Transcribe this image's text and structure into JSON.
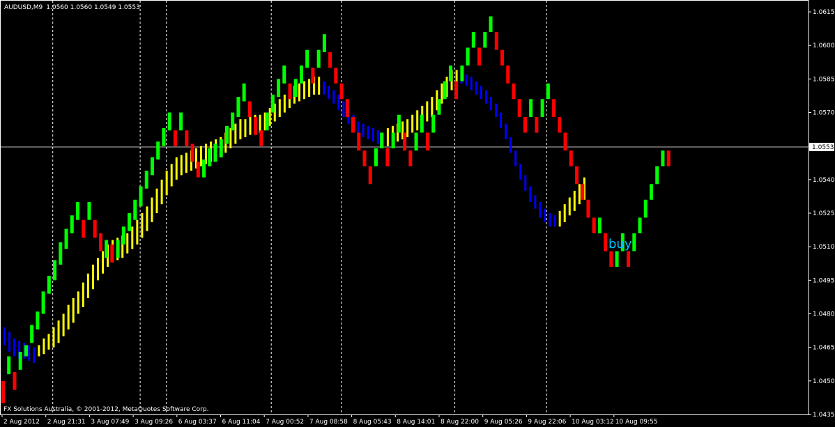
{
  "header": {
    "symbol": "AUDUSD,M9",
    "ohlc": "1.0560 1.0560 1.0549 1.0553"
  },
  "footer": {
    "copyright": "FX Solutions Australia, © 2001-2012, MetaQuotes Software Corp."
  },
  "colors": {
    "background": "#000000",
    "frame": "#ffffff",
    "grid": "#ffffff",
    "bull_candle": "#00ff00",
    "bear_candle": "#ff0000",
    "overlay_yellow": "#ffff00",
    "overlay_blue": "#0000ff",
    "signal_text": "#00bfff"
  },
  "chart_data": {
    "type": "ohlc-bars",
    "title": "AUDUSD,M9",
    "ylim": [
      1.0435,
      1.062
    ],
    "y_ticks": [
      "1.0615",
      "1.0600",
      "1.0585",
      "1.0570",
      "1.0555",
      "1.0540",
      "1.0525",
      "1.0510",
      "1.0495",
      "1.0480",
      "1.0465",
      "1.0450",
      "1.0435"
    ],
    "current_price": "1.0553",
    "x_labels": [
      "2 Aug 2012",
      "2 Aug 21:31",
      "3 Aug 07:49",
      "3 Aug 09:26",
      "6 Aug 03:37",
      "6 Aug 11:04",
      "7 Aug 00:52",
      "7 Aug 08:58",
      "8 Aug 05:43",
      "8 Aug 14:01",
      "8 Aug 22:00",
      "9 Aug 05:26",
      "9 Aug 22:06",
      "10 Aug 03:12",
      "10 Aug 09:55"
    ],
    "period_separators_after_label": [
      1,
      3,
      3.6,
      6,
      7.6,
      10.2,
      12.3
    ],
    "annotation": {
      "text": "buy"
    },
    "bars": [
      [
        1.045,
        1.044,
        "r"
      ],
      [
        1.0453,
        1.0461,
        "g"
      ],
      [
        1.0446,
        1.0454,
        "r"
      ],
      [
        1.0455,
        1.0463,
        "g"
      ],
      [
        1.0461,
        1.0466,
        "g"
      ],
      [
        1.0467,
        1.0475,
        "g"
      ],
      [
        1.0473,
        1.0481,
        "g"
      ],
      [
        1.048,
        1.049,
        "g"
      ],
      [
        1.0489,
        1.0497,
        "g"
      ],
      [
        1.0495,
        1.0504,
        "g"
      ],
      [
        1.0502,
        1.0512,
        "g"
      ],
      [
        1.0509,
        1.0518,
        "g"
      ],
      [
        1.0516,
        1.0524,
        "g"
      ],
      [
        1.0522,
        1.053,
        "g"
      ],
      [
        1.0522,
        1.0514,
        "r"
      ],
      [
        1.0522,
        1.053,
        "g"
      ],
      [
        1.0522,
        1.0514,
        "r"
      ],
      [
        1.0508,
        1.0516,
        "r"
      ],
      [
        1.0505,
        1.0513,
        "g"
      ],
      [
        1.0503,
        1.0511,
        "r"
      ],
      [
        1.0505,
        1.0513,
        "g"
      ],
      [
        1.0511,
        1.0519,
        "g"
      ],
      [
        1.0517,
        1.0525,
        "g"
      ],
      [
        1.0522,
        1.0531,
        "g"
      ],
      [
        1.0528,
        1.0537,
        "g"
      ],
      [
        1.0536,
        1.0544,
        "g"
      ],
      [
        1.0542,
        1.055,
        "g"
      ],
      [
        1.0549,
        1.0557,
        "g"
      ],
      [
        1.0555,
        1.0563,
        "g"
      ],
      [
        1.0562,
        1.057,
        "g"
      ],
      [
        1.0562,
        1.0555,
        "r"
      ],
      [
        1.0562,
        1.057,
        "g"
      ],
      [
        1.0562,
        1.0555,
        "r"
      ],
      [
        1.0556,
        1.0548,
        "r"
      ],
      [
        1.0548,
        1.0541,
        "r"
      ],
      [
        1.0541,
        1.0549,
        "g"
      ],
      [
        1.0546,
        1.0554,
        "g"
      ],
      [
        1.0548,
        1.0556,
        "g"
      ],
      [
        1.055,
        1.0558,
        "g"
      ],
      [
        1.0556,
        1.0564,
        "g"
      ],
      [
        1.0562,
        1.057,
        "g"
      ],
      [
        1.0568,
        1.0577,
        "g"
      ],
      [
        1.0575,
        1.0583,
        "g"
      ],
      [
        1.0575,
        1.0568,
        "r"
      ],
      [
        1.0568,
        1.056,
        "r"
      ],
      [
        1.0562,
        1.0555,
        "r"
      ],
      [
        1.0562,
        1.057,
        "g"
      ],
      [
        1.057,
        1.0578,
        "g"
      ],
      [
        1.0577,
        1.0585,
        "g"
      ],
      [
        1.0583,
        1.0591,
        "g"
      ],
      [
        1.0583,
        1.0576,
        "r"
      ],
      [
        1.0577,
        1.0585,
        "g"
      ],
      [
        1.0583,
        1.0591,
        "g"
      ],
      [
        1.059,
        1.0598,
        "g"
      ],
      [
        1.059,
        1.0583,
        "r"
      ],
      [
        1.059,
        1.0598,
        "g"
      ],
      [
        1.0597,
        1.0605,
        "g"
      ],
      [
        1.0597,
        1.059,
        "r"
      ],
      [
        1.059,
        1.0583,
        "r"
      ],
      [
        1.0583,
        1.0576,
        "r"
      ],
      [
        1.0576,
        1.0568,
        "r"
      ],
      [
        1.0568,
        1.0561,
        "r"
      ],
      [
        1.0561,
        1.0553,
        "r"
      ],
      [
        1.0553,
        1.0546,
        "r"
      ],
      [
        1.0546,
        1.0538,
        "r"
      ],
      [
        1.0546,
        1.0554,
        "g"
      ],
      [
        1.0554,
        1.0561,
        "g"
      ],
      [
        1.0554,
        1.0546,
        "r"
      ],
      [
        1.0554,
        1.0561,
        "g"
      ],
      [
        1.0561,
        1.0569,
        "g"
      ],
      [
        1.0561,
        1.0553,
        "r"
      ],
      [
        1.0553,
        1.0546,
        "r"
      ],
      [
        1.0553,
        1.0561,
        "g"
      ],
      [
        1.0561,
        1.0569,
        "g"
      ],
      [
        1.0561,
        1.0553,
        "r"
      ],
      [
        1.0561,
        1.0569,
        "g"
      ],
      [
        1.0569,
        1.0576,
        "g"
      ],
      [
        1.0576,
        1.0584,
        "g"
      ],
      [
        1.0584,
        1.0591,
        "g"
      ],
      [
        1.0584,
        1.0576,
        "r"
      ],
      [
        1.0584,
        1.0591,
        "g"
      ],
      [
        1.0591,
        1.0599,
        "g"
      ],
      [
        1.0599,
        1.0606,
        "g"
      ],
      [
        1.0599,
        1.0591,
        "r"
      ],
      [
        1.0599,
        1.0606,
        "g"
      ],
      [
        1.0606,
        1.0613,
        "g"
      ],
      [
        1.0606,
        1.0598,
        "r"
      ],
      [
        1.0598,
        1.0591,
        "r"
      ],
      [
        1.0591,
        1.0583,
        "r"
      ],
      [
        1.0583,
        1.0576,
        "r"
      ],
      [
        1.0576,
        1.0568,
        "r"
      ],
      [
        1.0568,
        1.0561,
        "r"
      ],
      [
        1.0568,
        1.0576,
        "g"
      ],
      [
        1.0568,
        1.0561,
        "r"
      ],
      [
        1.0568,
        1.0576,
        "g"
      ],
      [
        1.0576,
        1.0583,
        "g"
      ],
      [
        1.0576,
        1.0568,
        "r"
      ],
      [
        1.0568,
        1.0561,
        "r"
      ],
      [
        1.0561,
        1.0553,
        "r"
      ],
      [
        1.0553,
        1.0546,
        "r"
      ],
      [
        1.0546,
        1.0538,
        "r"
      ],
      [
        1.0538,
        1.0531,
        "r"
      ],
      [
        1.0531,
        1.0523,
        "r"
      ],
      [
        1.0523,
        1.0516,
        "r"
      ],
      [
        1.0516,
        1.0523,
        "g"
      ],
      [
        1.0516,
        1.0508,
        "r"
      ],
      [
        1.0508,
        1.0501,
        "r"
      ],
      [
        1.0501,
        1.0508,
        "g"
      ],
      [
        1.0508,
        1.0516,
        "g"
      ],
      [
        1.0508,
        1.0501,
        "r"
      ],
      [
        1.0508,
        1.0516,
        "g"
      ],
      [
        1.0516,
        1.0523,
        "g"
      ],
      [
        1.0523,
        1.0531,
        "g"
      ],
      [
        1.0531,
        1.0538,
        "g"
      ],
      [
        1.0538,
        1.0546,
        "g"
      ],
      [
        1.0546,
        1.0553,
        "g"
      ],
      [
        1.0553,
        1.0546,
        "r"
      ]
    ],
    "overlay": [
      [
        1.0474,
        1.0466,
        "b"
      ],
      [
        1.0472,
        1.0463,
        "b"
      ],
      [
        1.0469,
        1.0461,
        "b"
      ],
      [
        1.0468,
        1.046,
        "b"
      ],
      [
        1.0467,
        1.046,
        "b"
      ],
      [
        1.0466,
        1.0459,
        "b"
      ],
      [
        1.0465,
        1.0458,
        "b"
      ],
      [
        1.0466,
        1.0461,
        "y"
      ],
      [
        1.0469,
        1.0462,
        "y"
      ],
      [
        1.0471,
        1.0464,
        "y"
      ],
      [
        1.0474,
        1.0465,
        "y"
      ],
      [
        1.0477,
        1.0467,
        "y"
      ],
      [
        1.048,
        1.047,
        "y"
      ],
      [
        1.0484,
        1.0473,
        "y"
      ],
      [
        1.0487,
        1.0476,
        "y"
      ],
      [
        1.049,
        1.048,
        "y"
      ],
      [
        1.0494,
        1.0483,
        "y"
      ],
      [
        1.0498,
        1.0487,
        "y"
      ],
      [
        1.0502,
        1.0491,
        "y"
      ],
      [
        1.0505,
        1.0495,
        "y"
      ],
      [
        1.0508,
        1.0498,
        "y"
      ],
      [
        1.0511,
        1.0501,
        "y"
      ],
      [
        1.0513,
        1.0503,
        "y"
      ],
      [
        1.0514,
        1.0504,
        "y"
      ],
      [
        1.0515,
        1.0505,
        "y"
      ],
      [
        1.0516,
        1.0507,
        "y"
      ],
      [
        1.0519,
        1.0509,
        "y"
      ],
      [
        1.0522,
        1.0511,
        "y"
      ],
      [
        1.0525,
        1.0514,
        "y"
      ],
      [
        1.0528,
        1.0517,
        "y"
      ],
      [
        1.0532,
        1.0521,
        "y"
      ],
      [
        1.0536,
        1.0525,
        "y"
      ],
      [
        1.054,
        1.0529,
        "y"
      ],
      [
        1.0544,
        1.0533,
        "y"
      ],
      [
        1.0547,
        1.0537,
        "y"
      ],
      [
        1.055,
        1.054,
        "y"
      ],
      [
        1.0551,
        1.0542,
        "y"
      ],
      [
        1.0552,
        1.0543,
        "y"
      ],
      [
        1.0553,
        1.0544,
        "y"
      ],
      [
        1.0554,
        1.0545,
        "y"
      ],
      [
        1.0555,
        1.0546,
        "y"
      ],
      [
        1.0556,
        1.0547,
        "y"
      ],
      [
        1.0557,
        1.0548,
        "y"
      ],
      [
        1.0558,
        1.0549,
        "y"
      ],
      [
        1.0559,
        1.055,
        "y"
      ],
      [
        1.0561,
        1.0552,
        "y"
      ],
      [
        1.0563,
        1.0554,
        "y"
      ],
      [
        1.0565,
        1.0556,
        "y"
      ],
      [
        1.0567,
        1.0558,
        "y"
      ],
      [
        1.0567,
        1.0559,
        "y"
      ],
      [
        1.0568,
        1.056,
        "y"
      ],
      [
        1.0569,
        1.0561,
        "y"
      ],
      [
        1.0569,
        1.0561,
        "y"
      ],
      [
        1.057,
        1.0562,
        "y"
      ],
      [
        1.0572,
        1.0564,
        "y"
      ],
      [
        1.0574,
        1.0566,
        "y"
      ],
      [
        1.0576,
        1.0568,
        "y"
      ],
      [
        1.0578,
        1.057,
        "y"
      ],
      [
        1.058,
        1.0572,
        "y"
      ],
      [
        1.0582,
        1.0574,
        "y"
      ],
      [
        1.0583,
        1.0575,
        "y"
      ],
      [
        1.0584,
        1.0576,
        "y"
      ],
      [
        1.0585,
        1.0577,
        "y"
      ],
      [
        1.0586,
        1.0578,
        "y"
      ],
      [
        1.0586,
        1.0578,
        "y"
      ],
      [
        1.0584,
        1.0578,
        "b"
      ],
      [
        1.0582,
        1.0576,
        "b"
      ],
      [
        1.058,
        1.0574,
        "b"
      ],
      [
        1.0578,
        1.0571,
        "b"
      ],
      [
        1.0575,
        1.0568,
        "b"
      ],
      [
        1.0572,
        1.0565,
        "b"
      ],
      [
        1.0569,
        1.0562,
        "b"
      ],
      [
        1.0566,
        1.056,
        "b"
      ],
      [
        1.0565,
        1.0559,
        "b"
      ],
      [
        1.0564,
        1.0558,
        "b"
      ],
      [
        1.0563,
        1.0557,
        "b"
      ],
      [
        1.0562,
        1.0556,
        "b"
      ],
      [
        1.0561,
        1.0555,
        "b"
      ],
      [
        1.0563,
        1.0555,
        "y"
      ],
      [
        1.0564,
        1.0556,
        "y"
      ],
      [
        1.0565,
        1.0557,
        "y"
      ],
      [
        1.0566,
        1.0558,
        "y"
      ],
      [
        1.0567,
        1.0559,
        "y"
      ],
      [
        1.0569,
        1.0561,
        "y"
      ],
      [
        1.0571,
        1.0562,
        "y"
      ],
      [
        1.0573,
        1.0564,
        "y"
      ],
      [
        1.0575,
        1.0566,
        "y"
      ],
      [
        1.0577,
        1.0568,
        "y"
      ],
      [
        1.058,
        1.0571,
        "y"
      ],
      [
        1.0583,
        1.0574,
        "y"
      ],
      [
        1.0586,
        1.0577,
        "y"
      ],
      [
        1.0589,
        1.058,
        "y"
      ],
      [
        1.0589,
        1.0582,
        "y"
      ],
      [
        1.0588,
        1.0583,
        "b"
      ],
      [
        1.0587,
        1.0582,
        "b"
      ],
      [
        1.0586,
        1.058,
        "b"
      ],
      [
        1.0584,
        1.0578,
        "b"
      ],
      [
        1.0582,
        1.0576,
        "b"
      ],
      [
        1.058,
        1.0574,
        "b"
      ],
      [
        1.0577,
        1.0571,
        "b"
      ],
      [
        1.0574,
        1.0568,
        "b"
      ],
      [
        1.057,
        1.0563,
        "b"
      ],
      [
        1.0565,
        1.0558,
        "b"
      ],
      [
        1.0559,
        1.0552,
        "b"
      ],
      [
        1.0553,
        1.0546,
        "b"
      ],
      [
        1.0547,
        1.054,
        "b"
      ],
      [
        1.0542,
        1.0535,
        "b"
      ],
      [
        1.0537,
        1.053,
        "b"
      ],
      [
        1.0533,
        1.0527,
        "b"
      ],
      [
        1.053,
        1.0523,
        "b"
      ],
      [
        1.0527,
        1.0521,
        "b"
      ],
      [
        1.0525,
        1.0519,
        "b"
      ],
      [
        1.0524,
        1.0519,
        "b"
      ],
      [
        1.0526,
        1.0519,
        "y"
      ],
      [
        1.0529,
        1.0521,
        "y"
      ],
      [
        1.0532,
        1.0524,
        "y"
      ],
      [
        1.0535,
        1.0526,
        "y"
      ],
      [
        1.0538,
        1.0529,
        "y"
      ],
      [
        1.0541,
        1.0531,
        "y"
      ]
    ]
  }
}
